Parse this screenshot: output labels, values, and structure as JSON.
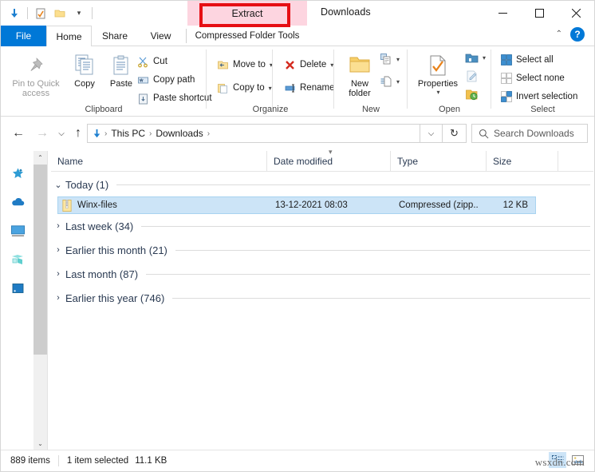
{
  "window": {
    "title": "Downloads",
    "minimize_label": "─",
    "maximize_label": "□",
    "close_label": "✕"
  },
  "quick_access_toolbar": {
    "items": [
      {
        "name": "downloads-icon",
        "label": "Downloads"
      },
      {
        "name": "properties-icon",
        "label": "Properties"
      },
      {
        "name": "new-folder-icon",
        "label": "New folder"
      }
    ],
    "customize_caret": "▾"
  },
  "contextual": {
    "banner_label": "Compressed Folder Tools",
    "tab_label": "Extract",
    "highlight_color": "#fdd5e0",
    "annotation_color": "#e60f14"
  },
  "tabs": [
    {
      "label": "File",
      "name": "tab-file",
      "active": false
    },
    {
      "label": "Home",
      "name": "tab-home",
      "active": true
    },
    {
      "label": "Share",
      "name": "tab-share",
      "active": false
    },
    {
      "label": "View",
      "name": "tab-view",
      "active": false
    }
  ],
  "ribbon": {
    "collapse_caret": "⌃",
    "help_label": "?",
    "groups": [
      {
        "label": "Clipboard"
      },
      {
        "label": "Organize"
      },
      {
        "label": "New"
      },
      {
        "label": "Open"
      },
      {
        "label": "Select"
      }
    ],
    "clipboard": {
      "pin_label": "Pin to Quick\naccess",
      "pin_label_l1": "Pin to Quick",
      "pin_label_l2": "access",
      "copy_label": "Copy",
      "paste_label": "Paste",
      "cut_label": "Cut",
      "copy_path_label": "Copy path",
      "paste_shortcut_label": "Paste shortcut"
    },
    "organize": {
      "move_to_label": "Move to",
      "copy_to_label": "Copy to",
      "delete_label": "Delete",
      "rename_label": "Rename"
    },
    "new_group": {
      "new_folder_l1": "New",
      "new_folder_l2": "folder",
      "new_item_label": "New item",
      "easy_access_label": "Easy access"
    },
    "open": {
      "properties_label": "Properties",
      "open_label": "Open",
      "edit_label": "Edit",
      "history_label": "History"
    },
    "select": {
      "select_all_label": "Select all",
      "select_none_label": "Select none",
      "invert_selection_label": "Invert selection"
    }
  },
  "navigation": {
    "back_label": "←",
    "forward_label": "→",
    "recent_label": "⌵",
    "up_label": "↑",
    "refresh_label": "↻",
    "address_dropdown": "⌵",
    "breadcrumb": [
      {
        "label": "This PC"
      },
      {
        "label": "Downloads"
      }
    ],
    "breadcrumb_separator": "›"
  },
  "search": {
    "placeholder": "Search Downloads",
    "value": ""
  },
  "nav_pane": {
    "items": [
      {
        "name": "quick-access-star-icon",
        "label": "Quick access"
      },
      {
        "name": "onedrive-cloud-icon",
        "label": "OneDrive"
      },
      {
        "name": "this-pc-monitor-icon",
        "label": "This PC"
      },
      {
        "name": "network-icon",
        "label": "Network"
      },
      {
        "name": "libraries-icon",
        "label": "Libraries"
      }
    ],
    "scroll_up": "⌃",
    "scroll_down": "⌄"
  },
  "columns": [
    {
      "label": "Name",
      "name": "column-name"
    },
    {
      "label": "Date modified",
      "name": "column-date-modified",
      "sorted": true
    },
    {
      "label": "Type",
      "name": "column-type"
    },
    {
      "label": "Size",
      "name": "column-size"
    }
  ],
  "groups": [
    {
      "label": "Today (1)",
      "expanded": true,
      "chevron": "⌄",
      "files": [
        {
          "name": "Winx-files",
          "date": "13-12-2021 08:03",
          "type": "Compressed (zipp...",
          "size": "12 KB",
          "icon": "zip-archive-icon",
          "selected": true
        }
      ]
    },
    {
      "label": "Last week (34)",
      "expanded": false,
      "chevron": "›",
      "files": []
    },
    {
      "label": "Earlier this month (21)",
      "expanded": false,
      "chevron": "›",
      "files": []
    },
    {
      "label": "Last month (87)",
      "expanded": false,
      "chevron": "›",
      "files": []
    },
    {
      "label": "Earlier this year (746)",
      "expanded": false,
      "chevron": "›",
      "files": []
    }
  ],
  "status": {
    "item_count": "889 items",
    "selection": "1 item selected",
    "selection_size": "11.1 KB"
  },
  "view_modes": {
    "details_label": "Details view",
    "large_icons_label": "Large icons view"
  },
  "watermark": {
    "text": "wsxdn.com"
  },
  "colors": {
    "accent": "#0078d7",
    "selection": "#cce4f7",
    "group_text": "#2a3a52",
    "contextual_pink": "#fdd5e0",
    "annotation_red": "#e60f14"
  }
}
